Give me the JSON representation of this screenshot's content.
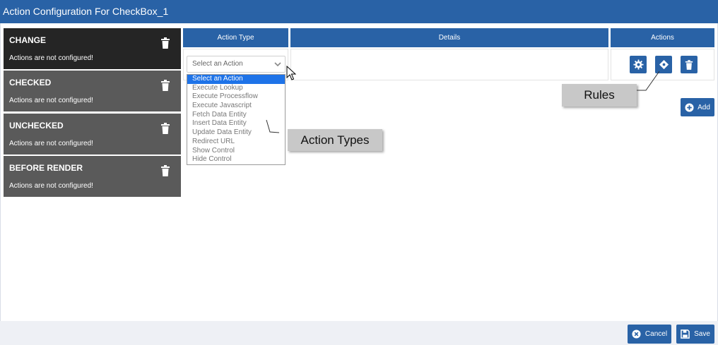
{
  "window": {
    "title": "Action Configuration For CheckBox_1"
  },
  "events": [
    {
      "title": "CHANGE",
      "status": "Actions are not configured!"
    },
    {
      "title": "CHECKED",
      "status": "Actions are not configured!"
    },
    {
      "title": "UNCHECKED",
      "status": "Actions are not configured!"
    },
    {
      "title": "BEFORE RENDER",
      "status": "Actions are not configured!"
    }
  ],
  "table": {
    "headers": {
      "action_type": "Action Type",
      "details": "Details",
      "actions": "Actions"
    }
  },
  "action_select": {
    "value": "Select an Action",
    "options": [
      "Select an Action",
      "Execute Lookup",
      "Execute Processflow",
      "Execute Javascript",
      "Fetch Data Entity",
      "Insert Data Entity",
      "Update Data Entity",
      "Redirect URL",
      "Show Control",
      "Hide Control"
    ]
  },
  "callouts": {
    "rules": "Rules",
    "action_types": "Action Types"
  },
  "buttons": {
    "add": "Add",
    "cancel": "Cancel",
    "save": "Save"
  },
  "icons": {
    "event_delete": "trash-icon",
    "settings": "gear-icon",
    "rules": "rules-diamond-icon",
    "row_delete": "trash-icon",
    "add": "plus-circle-icon",
    "cancel": "close-circle-icon",
    "save": "save-icon",
    "select_arrow": "chevron-down-icon",
    "pointer": "mouse-cursor-icon"
  },
  "colors": {
    "primary": "#2962a6",
    "selected_option": "#1e73e8",
    "panel_active": "#252525",
    "panel": "#5a5a5a"
  }
}
